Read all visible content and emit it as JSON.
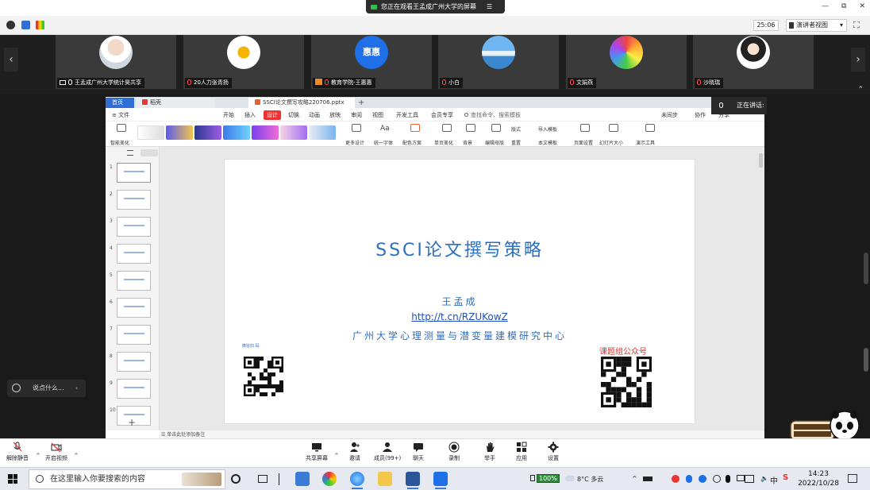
{
  "share_bar": {
    "text": "您正在观看王孟成广州大学的屏幕",
    "menu_glyph": "☰"
  },
  "window_controls": [
    "—",
    "⧉",
    "✕"
  ],
  "toolbar": {
    "timer": "25:06",
    "view_mode": "演讲者视图",
    "view_mode_caret": "▾",
    "fullscreen_glyph": "⛶"
  },
  "participants": [
    {
      "name": "王孟成广州大学统计昊共享",
      "avatar": "photo-woman"
    },
    {
      "name": "20人力张青扬",
      "avatar": "sunflower"
    },
    {
      "name": "教育学院-王惠惠",
      "avatar": "text",
      "avatar_text": "惠惠"
    },
    {
      "name": "小白",
      "avatar": "sea"
    },
    {
      "name": "文娟燕",
      "avatar": "rainbow"
    },
    {
      "name": "沙晓瑞",
      "avatar": "girl"
    }
  ],
  "strip_arrows": {
    "left": "‹",
    "right": "›"
  },
  "stage_caret": "⌃",
  "speaking": {
    "label": "正在讲话:"
  },
  "ppt": {
    "tabs": {
      "home": "首页",
      "daoke": "稻壳",
      "file": "SSCI论文撰写攻略220706.pptx",
      "add": "+"
    },
    "menu": [
      "≡ 文件",
      "开始",
      "插入",
      "设计",
      "切换",
      "动画",
      "放映",
      "审阅",
      "视图",
      "开发工具",
      "会员专享",
      "查找命令、搜索模板",
      "未同步",
      "协作",
      "分享"
    ],
    "active_menu": "设计",
    "ribbon": {
      "smart": "智能美化",
      "more_design": "更多设计",
      "font": "统一字体",
      "scheme": "配色方案",
      "unify": "单页美化",
      "background": "背景",
      "edit_master": "编辑母版",
      "format": "版式",
      "reset": "重置",
      "import": "导入模板",
      "local": "本文模板",
      "page_setup": "页面设置",
      "size": "幻灯片大小",
      "tools": "演示工具"
    },
    "thumbs": [
      1,
      2,
      3,
      4,
      5,
      6,
      7,
      8,
      9,
      10
    ],
    "thumb_add": "+",
    "notes": "单击此处添加备注",
    "slide": {
      "title": "SSCI论文撰写策略",
      "author": "王孟成",
      "link": "http://t.cn/RZUKowZ",
      "org": "广州大学心理测量与潜变量建模研究中心",
      "qr_label": "课题组公众号",
      "small_label": "微信扫 码"
    }
  },
  "chat": {
    "placeholder": "说点什么...",
    "arrow": "‹"
  },
  "meeting_bar": {
    "mute": "解除静音",
    "video": "开启视频",
    "share": "共享屏幕",
    "invite": "邀请",
    "members": "成员(99+)",
    "chat": "聊天",
    "record": "录制",
    "raise": "举手",
    "apps": "应用",
    "settings": "设置",
    "caret": "^"
  },
  "taskbar": {
    "search_placeholder": "在这里输入你要搜索的内容",
    "tray": {
      "battery": "100%",
      "weather": "8°C 多云",
      "ime": "中",
      "ime2": "S",
      "up_caret": "^"
    },
    "time": "14:23",
    "date": "2022/10/28"
  },
  "colors": {
    "slide_blue": "#2b6fc0",
    "qr_red": "#d9302c",
    "active_tab": "#e33333",
    "brand_blue": "#1e6fe8"
  }
}
